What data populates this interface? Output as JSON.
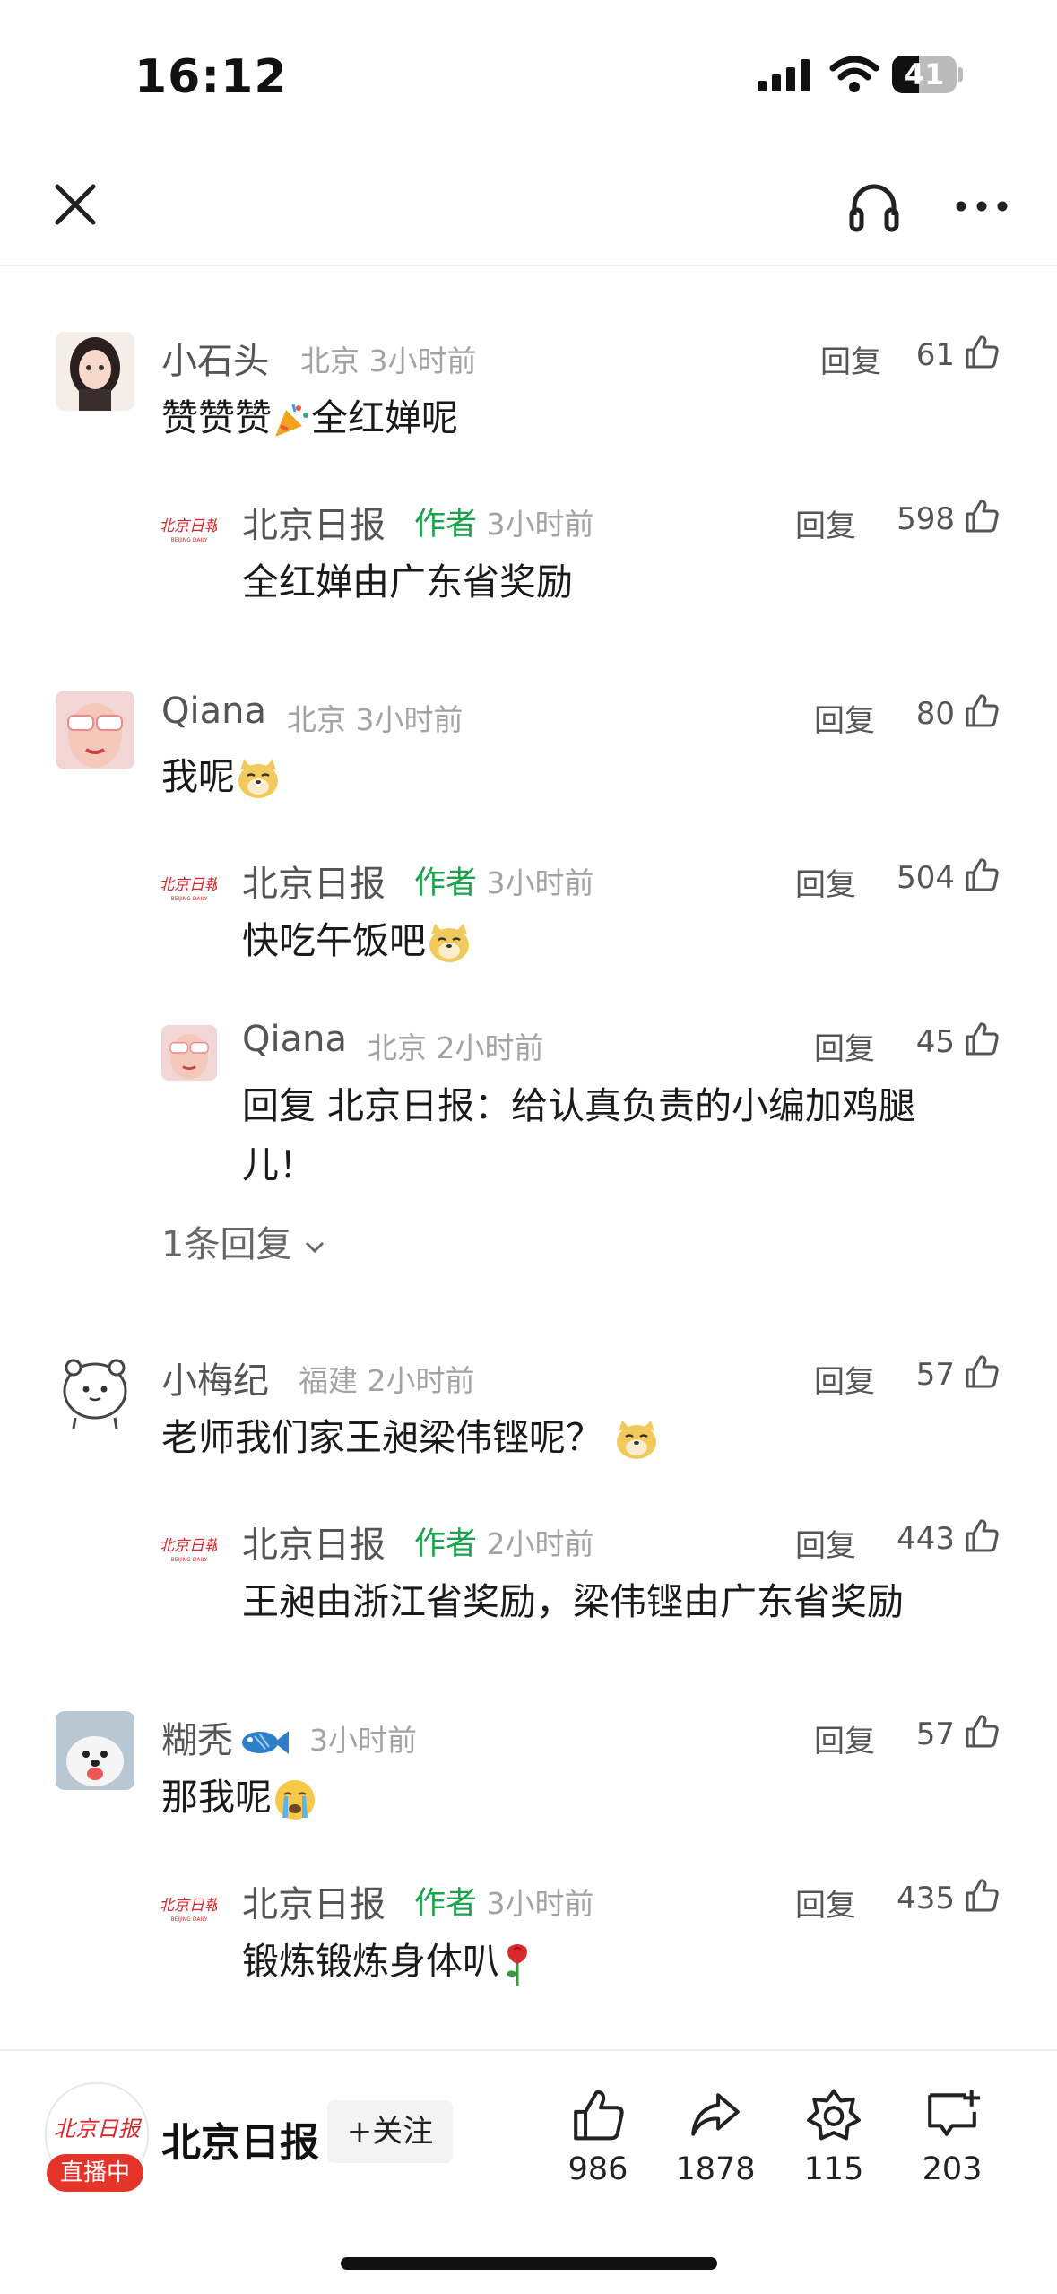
{
  "status_bar": {
    "time": "16:12",
    "battery": "41"
  },
  "comments": [
    {
      "user": "小石头",
      "location": "北京",
      "time": "3小时前",
      "text_before": "赞赞赞",
      "text_after": "全红婵呢",
      "reply_label": "回复",
      "likes": "61",
      "replies": [
        {
          "user": "北京日报",
          "badge": "作者",
          "time": "3小时前",
          "text": "全红婵由广东省奖励",
          "reply_label": "回复",
          "likes": "598"
        }
      ]
    },
    {
      "user": "Qiana",
      "location": "北京",
      "time": "3小时前",
      "text": "我呢",
      "reply_label": "回复",
      "likes": "80",
      "replies": [
        {
          "user": "北京日报",
          "badge": "作者",
          "time": "3小时前",
          "text": "快吃午饭吧",
          "reply_label": "回复",
          "likes": "504"
        },
        {
          "user": "Qiana",
          "location": "北京",
          "time": "2小时前",
          "text_line1": "回复 北京日报：给认真负责的小编加鸡腿",
          "text_line2": "儿！",
          "reply_label": "回复",
          "likes": "45"
        }
      ],
      "more_replies": "1条回复"
    },
    {
      "user": "小梅纪",
      "location": "福建",
      "time": "2小时前",
      "text": "老师我们家王昶梁伟铿呢？",
      "reply_label": "回复",
      "likes": "57",
      "replies": [
        {
          "user": "北京日报",
          "badge": "作者",
          "time": "2小时前",
          "text": "王昶由浙江省奖励，梁伟铿由广东省奖励",
          "reply_label": "回复",
          "likes": "443"
        }
      ]
    },
    {
      "user": "糊秃",
      "time": "3小时前",
      "text": "那我呢",
      "reply_label": "回复",
      "likes": "57",
      "replies": [
        {
          "user": "北京日报",
          "badge": "作者",
          "time": "3小时前",
          "text": "锻炼锻炼身体叭",
          "reply_label": "回复",
          "likes": "435"
        }
      ]
    }
  ],
  "bottom_bar": {
    "logo_text": "北京日报",
    "live_label": "直播中",
    "publisher": "北京日报",
    "follow_label": "+关注",
    "likes": "986",
    "shares": "1878",
    "collects": "115",
    "comments": "203"
  },
  "colors": {
    "author_green": "#1aa34a",
    "live_red": "#e5352b"
  }
}
